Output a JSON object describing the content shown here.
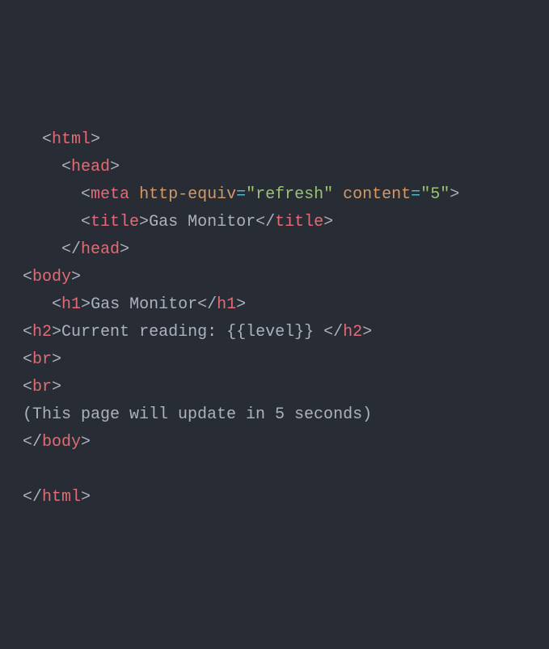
{
  "lines": {
    "l1": {
      "b1": "<",
      "tag1": "html",
      "b2": ">"
    },
    "l2": {
      "b1": "<",
      "tag1": "head",
      "b2": ">"
    },
    "l3": {
      "b1": "<",
      "tag1": "meta",
      "sp": " ",
      "attr1": "http-equiv",
      "eq1": "=",
      "str1": "\"refresh\"",
      "sp2": " ",
      "attr2": "content",
      "eq2": "=",
      "str2": "\"5\"",
      "b2": ">"
    },
    "l4": {
      "b1": "<",
      "tag1": "title",
      "b2": ">",
      "txt": "Gas Monitor",
      "b3": "</",
      "tag2": "title",
      "b4": ">"
    },
    "l5": {
      "b1": "</",
      "tag1": "head",
      "b2": ">"
    },
    "l6": {
      "b1": "<",
      "tag1": "body",
      "b2": ">"
    },
    "l7": {
      "b1": "<",
      "tag1": "h1",
      "b2": ">",
      "txt": "Gas Monitor",
      "b3": "</",
      "tag2": "h1",
      "b4": ">"
    },
    "l8": {
      "b1": "<",
      "tag1": "h2",
      "b2": ">",
      "txt": "Current reading: {{level}} ",
      "b3": "</",
      "tag2": "h2",
      "b4": ">"
    },
    "l9": {
      "b1": "<",
      "tag1": "br",
      "b2": ">"
    },
    "l10": {
      "b1": "<",
      "tag1": "br",
      "b2": ">"
    },
    "l11": {
      "txt": "(This page will update in 5 seconds)"
    },
    "l12": {
      "b1": "</",
      "tag1": "body",
      "b2": ">"
    },
    "l13": {
      "b1": "</",
      "tag1": "html",
      "b2": ">"
    }
  }
}
